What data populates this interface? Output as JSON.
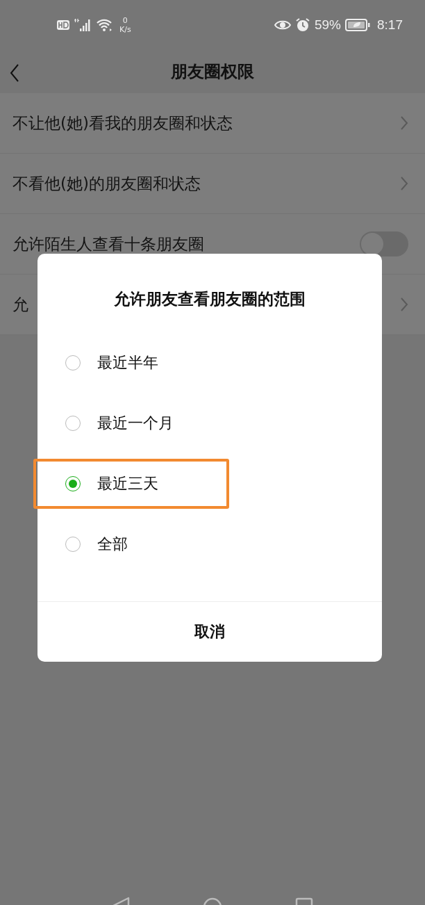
{
  "status_bar": {
    "net_speed_value": "0",
    "net_speed_unit": "K/s",
    "battery": "59%",
    "time": "8:17"
  },
  "header": {
    "title": "朋友圈权限"
  },
  "settings": [
    {
      "kind": "link",
      "label": "不让他(她)看我的朋友圈和状态"
    },
    {
      "kind": "link",
      "label": "不看他(她)的朋友圈和状态"
    },
    {
      "kind": "toggle",
      "label": "允许陌生人查看十条朋友圈",
      "on": false
    },
    {
      "kind": "link",
      "label": "允"
    }
  ],
  "dialog": {
    "title": "允许朋友查看朋友圈的范围",
    "options": [
      {
        "label": "最近半年",
        "selected": false
      },
      {
        "label": "最近一个月",
        "selected": false
      },
      {
        "label": "最近三天",
        "selected": true
      },
      {
        "label": "全部",
        "selected": false
      }
    ],
    "cancel": "取消"
  }
}
